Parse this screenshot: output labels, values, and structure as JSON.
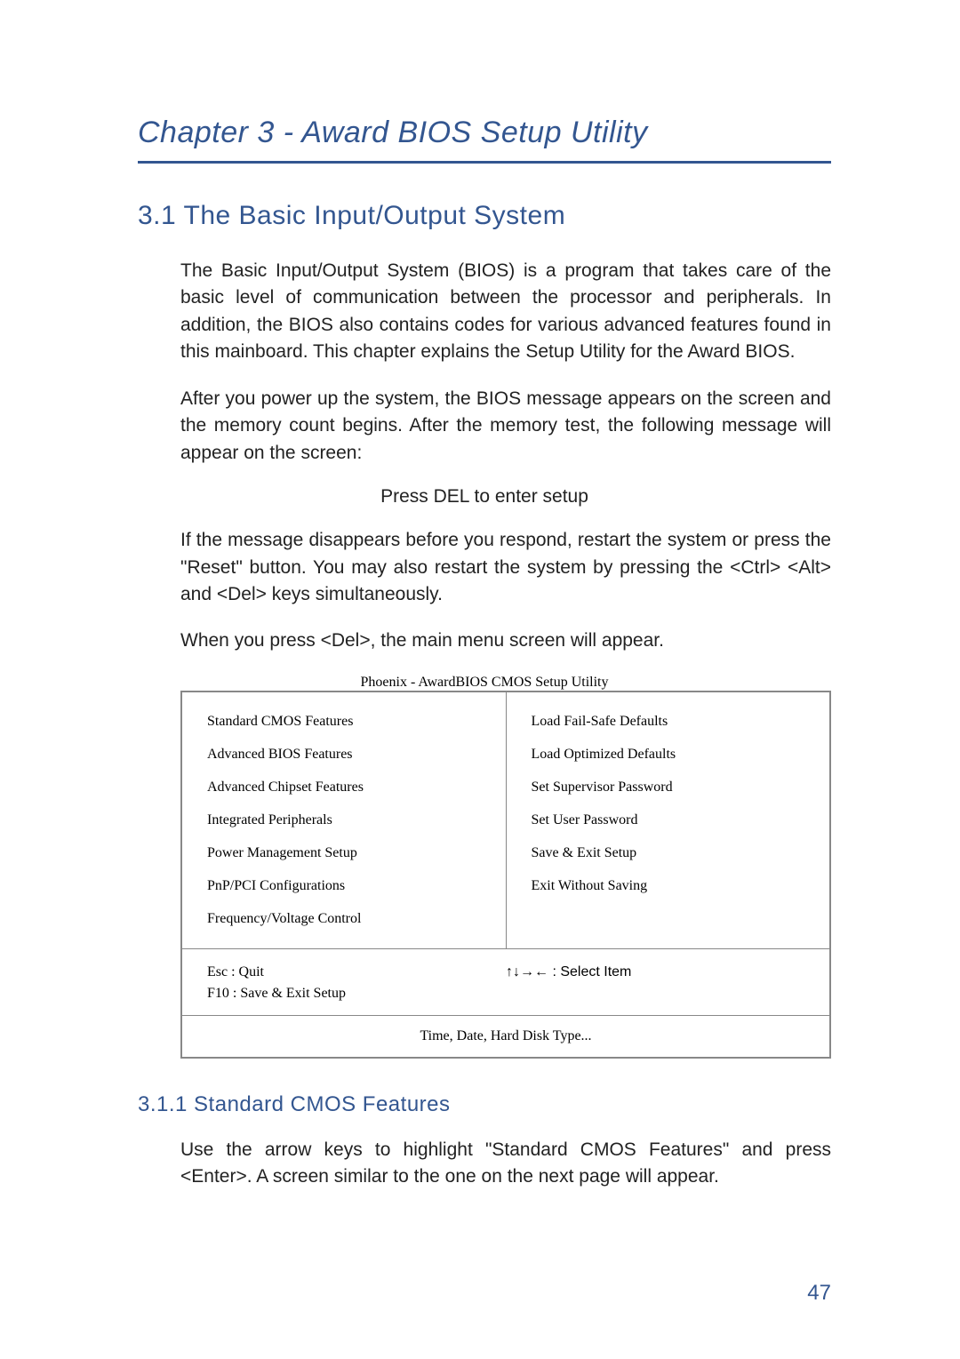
{
  "chapter_title": "Chapter 3 - Award BIOS Setup Utility",
  "section_heading": "3.1 The Basic Input/Output System",
  "para1": "The Basic Input/Output System (BIOS) is a program that takes care of the basic level of communication between the processor and peripherals. In addition, the BIOS also contains codes for various advanced features found in this mainboard. This chapter explains the Setup Utility for the Award BIOS.",
  "para2": "After you power up the system, the BIOS message appears on the screen and the memory count begins. After the memory test, the following message will appear on the screen:",
  "press_del": "Press DEL to enter setup",
  "para3": "If the message disappears before you respond, restart the system or press the \"Reset\" button. You may also restart the system by pressing the <Ctrl> <Alt> and <Del> keys simultaneously.",
  "para4": "When you press <Del>, the main menu screen will appear.",
  "bios": {
    "caption": "Phoenix - AwardBIOS CMOS Setup Utility",
    "left_items": [
      "Standard CMOS Features",
      "Advanced BIOS Features",
      "Advanced Chipset Features",
      "Integrated Peripherals",
      "Power Management Setup",
      "PnP/PCI Configurations",
      "Frequency/Voltage Control"
    ],
    "right_items": [
      "Load Fail-Safe Defaults",
      "Load Optimized Defaults",
      "Set Supervisor Password",
      "Set User Password",
      "Save & Exit Setup",
      "Exit Without Saving"
    ],
    "footer_left_line1": "Esc   :   Quit",
    "footer_left_line2": "F10   :   Save & Exit Setup",
    "footer_right": "↑↓→←    :   Select Item",
    "status": "Time, Date, Hard Disk Type..."
  },
  "subsection_heading": "3.1.1 Standard CMOS Features",
  "para5": "Use the arrow keys to highlight \"Standard CMOS Features\" and press <Enter>. A screen similar to the one on the next page will appear.",
  "page_number": "47"
}
